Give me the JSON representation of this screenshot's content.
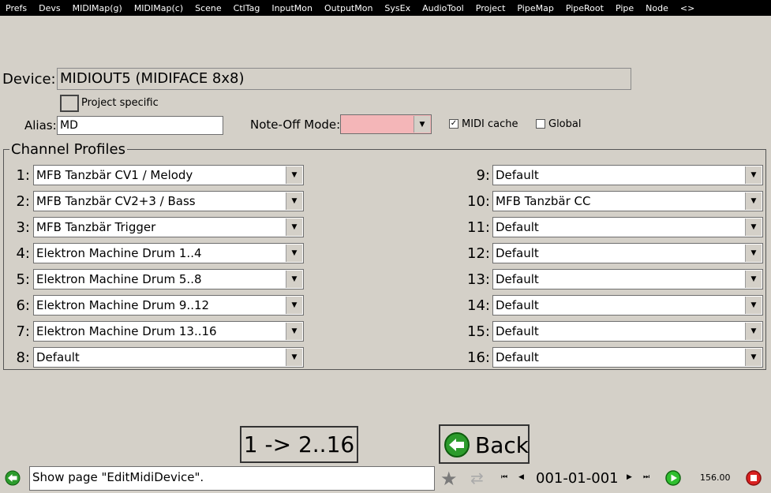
{
  "menu": [
    "Prefs",
    "Devs",
    "MIDIMap(g)",
    "MIDIMap(c)",
    "Scene",
    "CtlTag",
    "InputMon",
    "OutputMon",
    "SysEx",
    "AudioTool",
    "Project",
    "PipeMap",
    "PipeRoot",
    "Pipe",
    "Node",
    "<>"
  ],
  "device": {
    "label": "Device:",
    "value": "MIDIOUT5 (MIDIFACE 8x8)"
  },
  "project_specific": {
    "label": "Project specific",
    "checked": false
  },
  "alias": {
    "label": "Alias:",
    "value": "MD"
  },
  "note_off": {
    "label": "Note-Off Mode:",
    "value": "",
    "color": "#f4b6b8"
  },
  "midi_cache": {
    "label": "MIDI cache",
    "checked": true
  },
  "global": {
    "label": "Global",
    "checked": false
  },
  "channel_profiles": {
    "title": "Channel Profiles",
    "left": [
      {
        "num": "1:",
        "value": "MFB Tanzbär CV1 / Melody"
      },
      {
        "num": "2:",
        "value": "MFB Tanzbär CV2+3 / Bass"
      },
      {
        "num": "3:",
        "value": "MFB Tanzbär Trigger"
      },
      {
        "num": "4:",
        "value": "Elektron Machine Drum 1..4"
      },
      {
        "num": "5:",
        "value": "Elektron Machine Drum 5..8"
      },
      {
        "num": "6:",
        "value": "Elektron Machine Drum 9..12"
      },
      {
        "num": "7:",
        "value": "Elektron Machine Drum 13..16"
      },
      {
        "num": "8:",
        "value": "Default"
      }
    ],
    "right": [
      {
        "num": "9:",
        "value": "Default"
      },
      {
        "num": "10:",
        "value": "MFB Tanzbär CC"
      },
      {
        "num": "11:",
        "value": "Default"
      },
      {
        "num": "12:",
        "value": "Default"
      },
      {
        "num": "13:",
        "value": "Default"
      },
      {
        "num": "14:",
        "value": "Default"
      },
      {
        "num": "15:",
        "value": "Default"
      },
      {
        "num": "16:",
        "value": "Default"
      }
    ]
  },
  "buttons": {
    "copy": "1 -> 2..16",
    "back": "Back"
  },
  "status": {
    "message": "Show page \"EditMidiDevice\".",
    "position": "001-01-001",
    "tempo": "156.00"
  }
}
